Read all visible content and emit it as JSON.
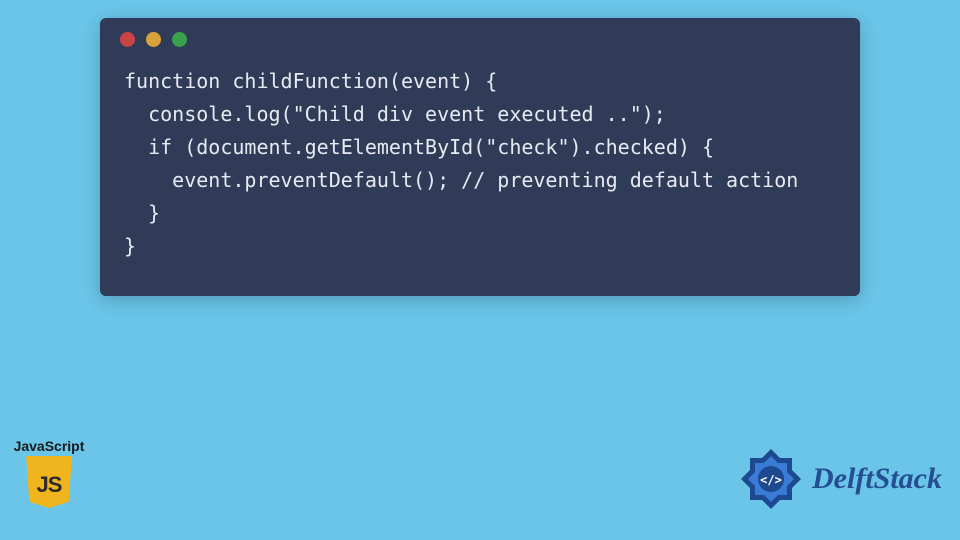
{
  "window": {
    "dots": {
      "red": "#c94444",
      "yellow": "#d9a23a",
      "green": "#3aa24a"
    }
  },
  "code": {
    "lines": [
      "function childFunction(event) {",
      "  console.log(\"Child div event executed ..\");",
      "  if (document.getElementById(\"check\").checked) {",
      "    event.preventDefault(); // preventing default action",
      "  }",
      "}"
    ]
  },
  "js_badge": {
    "label": "JavaScript",
    "logo_letters": "JS"
  },
  "brand": {
    "name": "DelftStack",
    "glyph": "</>"
  },
  "colors": {
    "page_bg": "#6ac5e9",
    "card_bg": "#2f3b57",
    "code_fg": "#e6eaf2",
    "js_logo_bg": "#f0b41e",
    "brand_primary": "#244f91"
  }
}
